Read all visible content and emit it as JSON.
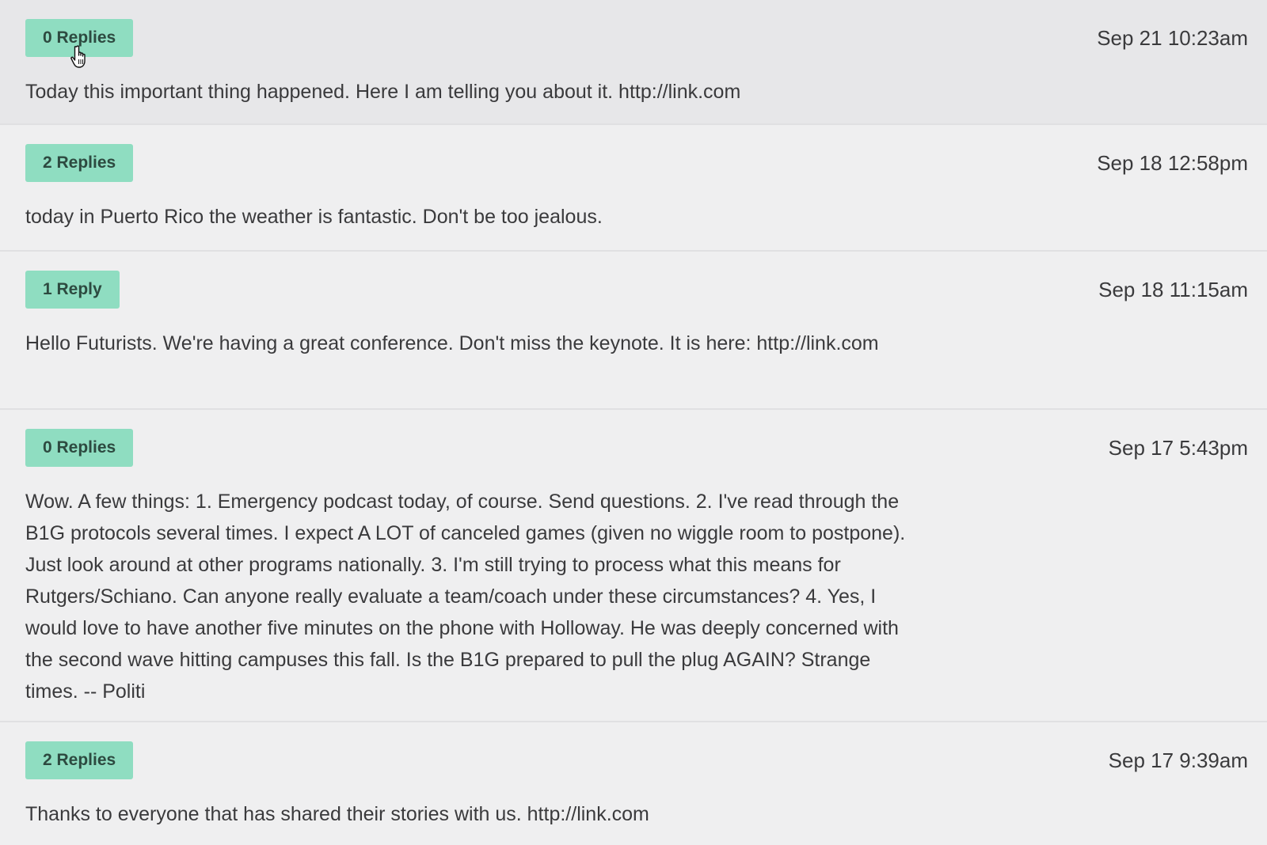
{
  "posts": [
    {
      "replies_label": "0 Replies",
      "timestamp": "Sep 21 10:23am",
      "text": "Today this important thing happened. Here I am telling you about it. http://link.com"
    },
    {
      "replies_label": "2 Replies",
      "timestamp": "Sep 18 12:58pm",
      "text": "today in Puerto Rico the weather is fantastic. Don't be too jealous."
    },
    {
      "replies_label": "1 Reply",
      "timestamp": "Sep 18 11:15am",
      "text": "Hello Futurists. We're having a great conference. Don't miss the keynote. It is here: http://link.com"
    },
    {
      "replies_label": "0 Replies",
      "timestamp": "Sep 17 5:43pm",
      "text": "Wow. A few things: 1. Emergency podcast today, of course. Send questions. 2. I've read through the B1G protocols several times. I expect A LOT of canceled games (given no wiggle room to postpone). Just look around at other programs nationally. 3. I'm still trying to process what this means for Rutgers/Schiano. Can anyone really evaluate a team/coach under these circumstances? 4. Yes, I would love to have another five minutes on the phone with Holloway. He was deeply concerned with the second wave hitting campuses this fall. Is the B1G prepared to pull the plug AGAIN? Strange times. -- Politi"
    },
    {
      "replies_label": "2 Replies",
      "timestamp": "Sep 17 9:39am",
      "text": "Thanks to everyone that has shared their stories with us. http://link.com"
    }
  ],
  "cursor_icon": "hand-pointer-icon"
}
